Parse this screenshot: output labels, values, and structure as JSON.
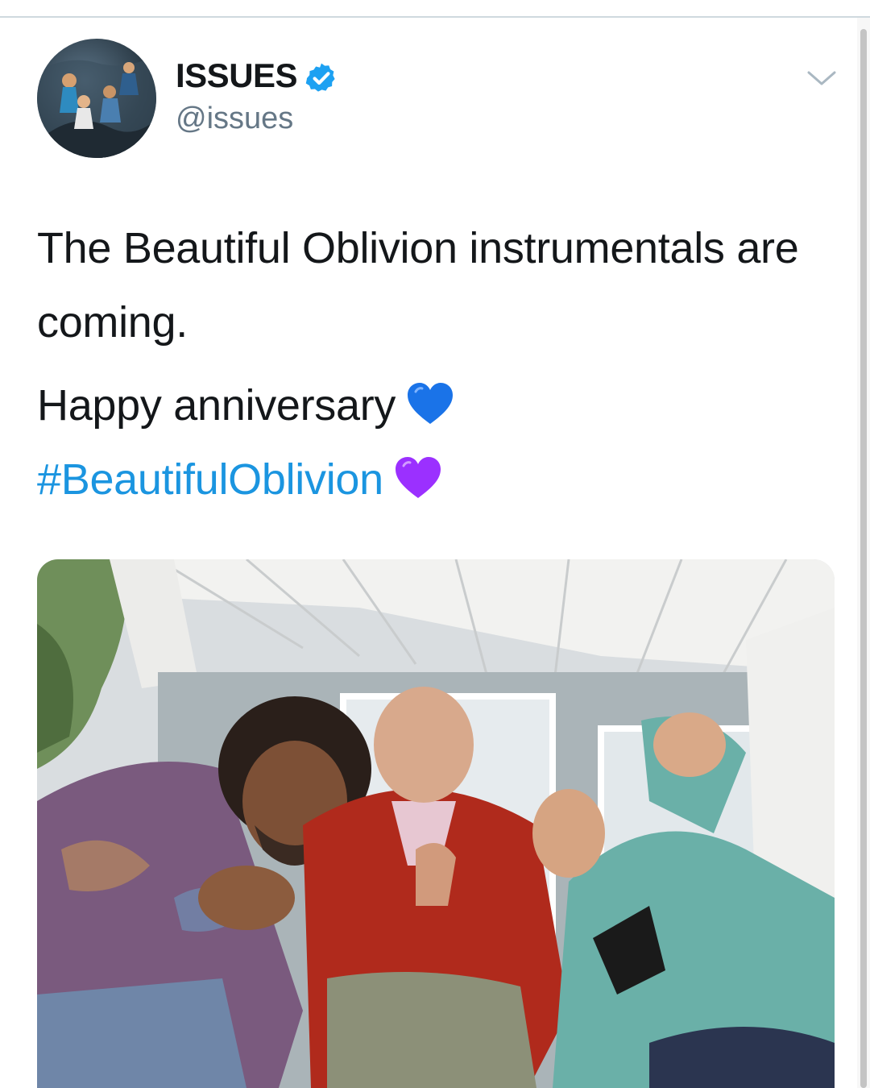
{
  "tweet": {
    "author": {
      "display_name": "ISSUES",
      "handle": "@issues",
      "verified": true,
      "avatar_icon": "avatar-image"
    },
    "menu_icon": "chevron-down-icon",
    "text_line": "The Beautiful Oblivion instrumentals are coming.",
    "line2": "Happy anniversary",
    "hashtag": "#BeautifulOblivion",
    "emoji_1": "blue-heart-icon",
    "emoji_2": "purple-heart-icon",
    "media_icon": "band-photo-image"
  },
  "colors": {
    "link": "#1b95e0",
    "verified": "#1da1f2",
    "secondary_text": "#657786",
    "blue_heart": "#1a73e8",
    "purple_heart": "#9b30ff"
  }
}
